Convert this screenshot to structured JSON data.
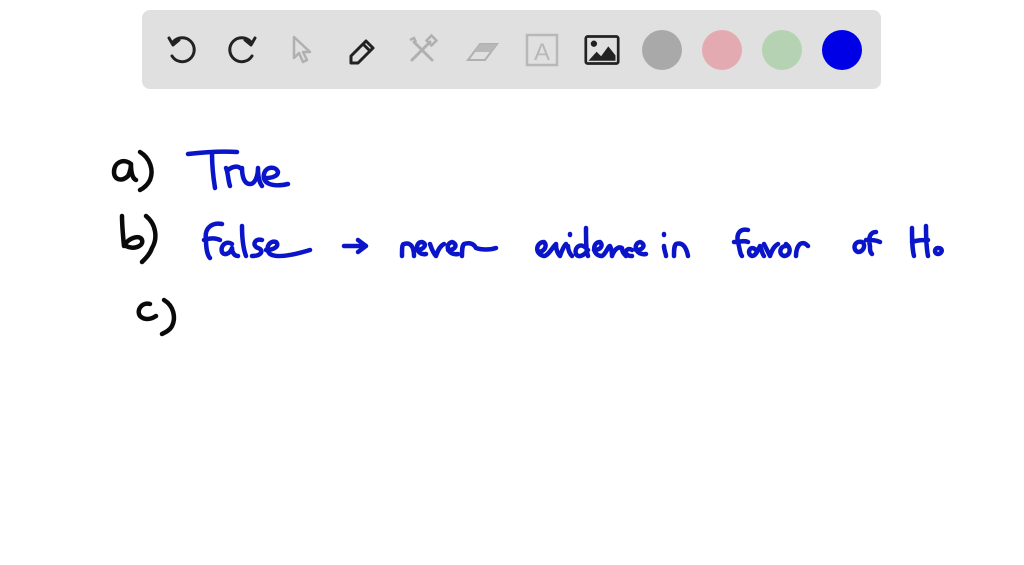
{
  "toolbar": {
    "tools": [
      {
        "name": "undo",
        "icon": "undo-icon",
        "state": "enabled"
      },
      {
        "name": "redo",
        "icon": "redo-icon",
        "state": "enabled"
      },
      {
        "name": "select",
        "icon": "pointer-icon",
        "state": "disabled"
      },
      {
        "name": "pen",
        "icon": "pencil-icon",
        "state": "active"
      },
      {
        "name": "tools",
        "icon": "wrench-hammer-icon",
        "state": "disabled"
      },
      {
        "name": "eraser",
        "icon": "eraser-icon",
        "state": "disabled"
      },
      {
        "name": "text",
        "icon": "text-box-icon",
        "label": "A",
        "state": "disabled"
      },
      {
        "name": "image",
        "icon": "image-icon",
        "state": "enabled"
      }
    ],
    "colors": [
      {
        "name": "gray",
        "hex": "#a9a9a9"
      },
      {
        "name": "pink",
        "hex": "#e3aab1"
      },
      {
        "name": "green",
        "hex": "#b5d3b3"
      },
      {
        "name": "blue",
        "hex": "#0000e6",
        "selected": true
      }
    ],
    "icon_color_enabled": "#222222",
    "icon_color_disabled": "#b0b0b0",
    "background": "#e0e0e0"
  },
  "canvas": {
    "answers": [
      {
        "label": "a)",
        "text": "True"
      },
      {
        "label": "b)",
        "text": "False → never evidence in favor of Ho"
      },
      {
        "label": "c)",
        "text": ""
      }
    ],
    "ink_colors": {
      "label": "#0a0a0a",
      "answer": "#0a14c8"
    }
  }
}
